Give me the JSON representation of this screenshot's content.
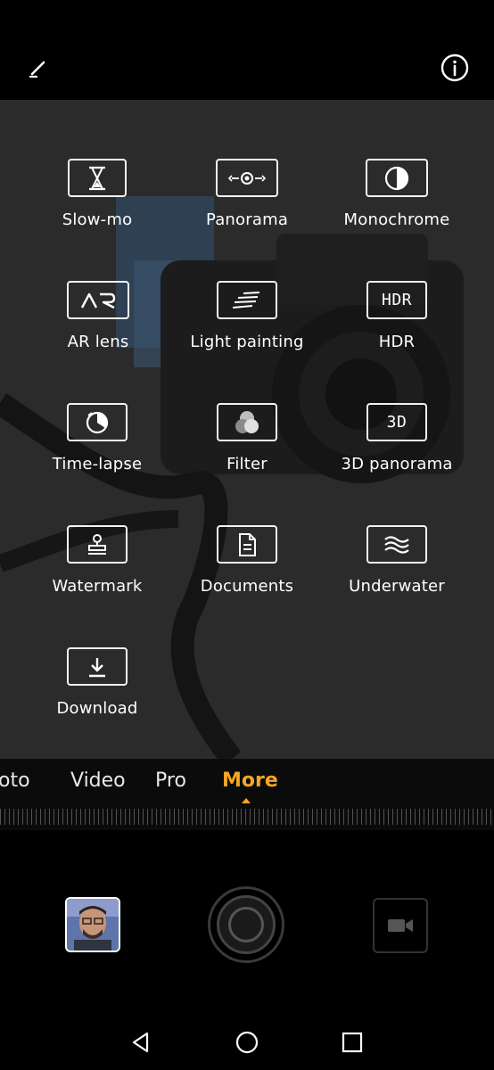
{
  "top_bar": {
    "edit_icon": "pencil-icon",
    "info_icon": "info-icon"
  },
  "modes": [
    {
      "id": "slow-mo",
      "label": "Slow-mo",
      "icon": "hourglass-icon"
    },
    {
      "id": "panorama",
      "label": "Panorama",
      "icon": "panorama-icon"
    },
    {
      "id": "monochrome",
      "label": "Monochrome",
      "icon": "monochrome-icon"
    },
    {
      "id": "ar-lens",
      "label": "AR lens",
      "icon": "ar-icon",
      "icon_text": "AR"
    },
    {
      "id": "light-painting",
      "label": "Light painting",
      "icon": "light-streaks-icon"
    },
    {
      "id": "hdr",
      "label": "HDR",
      "icon": "hdr-icon",
      "icon_text": "HDR"
    },
    {
      "id": "time-lapse",
      "label": "Time-lapse",
      "icon": "timer-icon"
    },
    {
      "id": "filter",
      "label": "Filter",
      "icon": "filter-icon"
    },
    {
      "id": "3d-panorama",
      "label": "3D panorama",
      "icon": "3d-icon",
      "icon_text": "3D"
    },
    {
      "id": "watermark",
      "label": "Watermark",
      "icon": "stamp-icon"
    },
    {
      "id": "documents",
      "label": "Documents",
      "icon": "document-icon"
    },
    {
      "id": "underwater",
      "label": "Underwater",
      "icon": "waves-icon"
    },
    {
      "id": "download",
      "label": "Download",
      "icon": "download-icon"
    }
  ],
  "mode_bar": {
    "tabs": [
      {
        "label": "oto"
      },
      {
        "label": "Video"
      },
      {
        "label": "Pro"
      },
      {
        "label": "More",
        "active": true
      }
    ],
    "accent_color": "#f5a623"
  },
  "controls": {
    "gallery_thumbnail": "gallery-thumbnail",
    "shutter": "shutter-button",
    "video_icon": "video-camera-icon"
  },
  "navbar": {
    "back": "back-triangle-icon",
    "home": "home-circle-icon",
    "recents": "recents-square-icon"
  }
}
